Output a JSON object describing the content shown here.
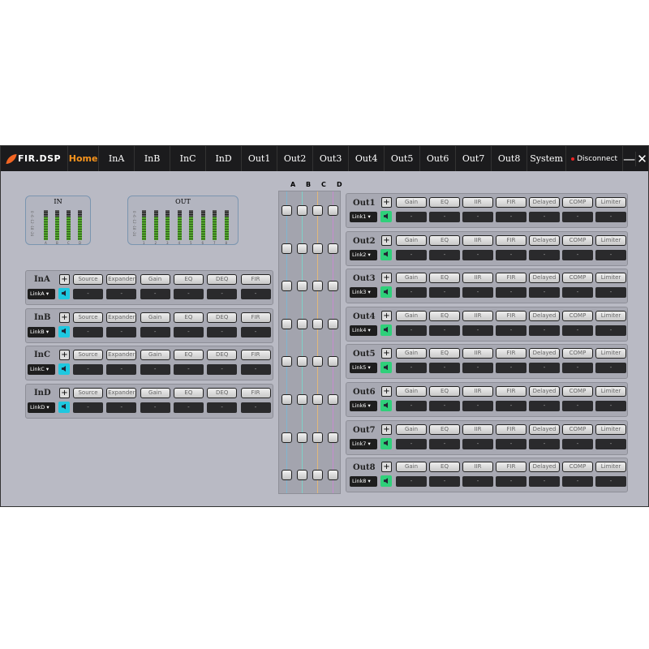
{
  "app": {
    "logo": "FIR.DSP",
    "tabs": [
      "Home",
      "InA",
      "InB",
      "InC",
      "InD",
      "Out1",
      "Out2",
      "Out3",
      "Out4",
      "Out5",
      "Out6",
      "Out7",
      "Out8",
      "System"
    ],
    "active_tab": "Home",
    "disconnect": "Disconnect",
    "minimize": "—",
    "close": "✕"
  },
  "meters": {
    "in_title": "IN",
    "in_labels": [
      "A",
      "B",
      "C",
      "D"
    ],
    "out_title": "OUT",
    "out_labels": [
      "1",
      "2",
      "3",
      "4",
      "5",
      "6",
      "7",
      "8"
    ],
    "scale": "0 -6 -12 -18 -24"
  },
  "matrix": {
    "columns": [
      "A",
      "B",
      "C",
      "D"
    ],
    "colors": [
      "#7fb6d0",
      "#7ed0c8",
      "#e0b87a",
      "#c88ad0"
    ]
  },
  "inputs": {
    "buttons": [
      "Source",
      "Expander",
      "Gain",
      "EQ",
      "DEQ",
      "FIR"
    ],
    "channels": [
      {
        "name": "InA",
        "link": "LinkA"
      },
      {
        "name": "InB",
        "link": "LinkB"
      },
      {
        "name": "InC",
        "link": "LinkC"
      },
      {
        "name": "InD",
        "link": "LinkD"
      }
    ],
    "value": "-",
    "speaker_color": "#1ec8e0"
  },
  "outputs": {
    "buttons": [
      "Gain",
      "EQ",
      "IIR",
      "FIR",
      "Delayed",
      "COMP",
      "Limiter"
    ],
    "channels": [
      {
        "name": "Out1",
        "link": "Link1"
      },
      {
        "name": "Out2",
        "link": "Link2"
      },
      {
        "name": "Out3",
        "link": "Link3"
      },
      {
        "name": "Out4",
        "link": "Link4"
      },
      {
        "name": "Out5",
        "link": "Link5"
      },
      {
        "name": "Out6",
        "link": "Link6"
      },
      {
        "name": "Out7",
        "link": "Link7"
      },
      {
        "name": "Out8",
        "link": "Link8"
      }
    ],
    "value": "-",
    "speaker_color": "#2fd07a"
  }
}
